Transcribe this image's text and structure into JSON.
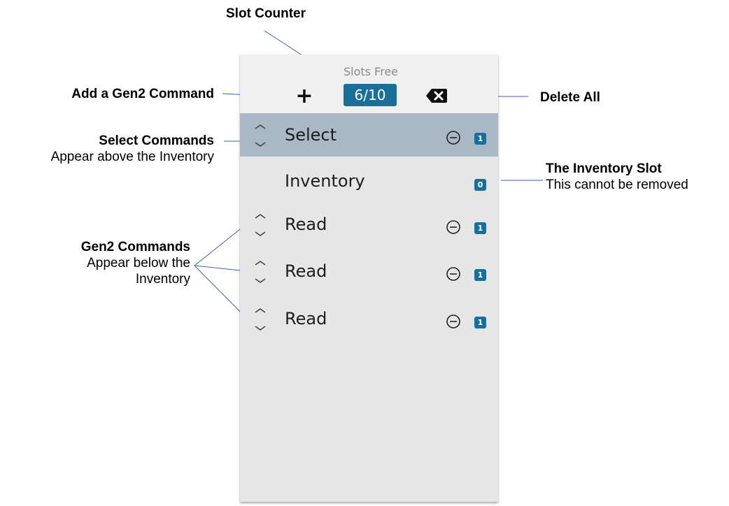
{
  "callouts": {
    "slot_counter": "Slot Counter",
    "add_command": "Add a Gen2 Command",
    "delete_all": "Delete All",
    "select_title": "Select Commands",
    "select_desc": "Appear above the Inventory",
    "inventory_title": "The Inventory Slot",
    "inventory_desc": "This cannot be removed",
    "gen2_title": "Gen2 Commands",
    "gen2_desc_line1": "Appear below the",
    "gen2_desc_line2": "Inventory"
  },
  "panel": {
    "slots_label": "Slots Free",
    "slots_counter": "6/10",
    "add_symbol": "+",
    "rows": [
      {
        "label": "Select",
        "count": "1",
        "selected": true
      },
      {
        "label": "Inventory",
        "count": "0"
      },
      {
        "label": "Read",
        "count": "1"
      },
      {
        "label": "Read",
        "count": "1"
      },
      {
        "label": "Read",
        "count": "1"
      }
    ]
  },
  "colors": {
    "accent": "#1a6f98",
    "selected_row": "#aab7c4",
    "panel_bg": "#e6e6e6",
    "toolbar_bg": "#f0f0f0",
    "callout_line": "#3f5fb0"
  },
  "icons": {
    "add": "plus-icon",
    "delete_all": "backspace-x-icon",
    "reorder": "up-down-chevrons-icon",
    "remove": "minus-circle-icon"
  }
}
